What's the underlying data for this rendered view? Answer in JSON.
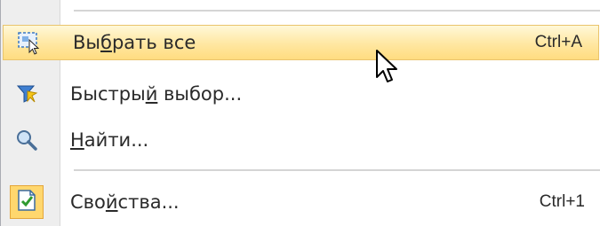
{
  "menu": {
    "items": [
      {
        "label": "Выбрать все",
        "shortcut": "Ctrl+A",
        "icon": "select-all-icon",
        "state": "highlighted"
      },
      {
        "label": "Быстрый выбор...",
        "shortcut": "",
        "icon": "quick-select-filter-icon"
      },
      {
        "label": "Найти...",
        "shortcut": "",
        "icon": "magnifier-icon"
      },
      {
        "label": "Свойства...",
        "shortcut": "Ctrl+1",
        "icon": "properties-check-icon",
        "state": "checked"
      }
    ]
  },
  "colors": {
    "highlight_top": "#fff8d8",
    "highlight_bottom": "#ffdc80",
    "highlight_border": "#e9c46d",
    "checked_icon_bg": "#ffd76e"
  }
}
